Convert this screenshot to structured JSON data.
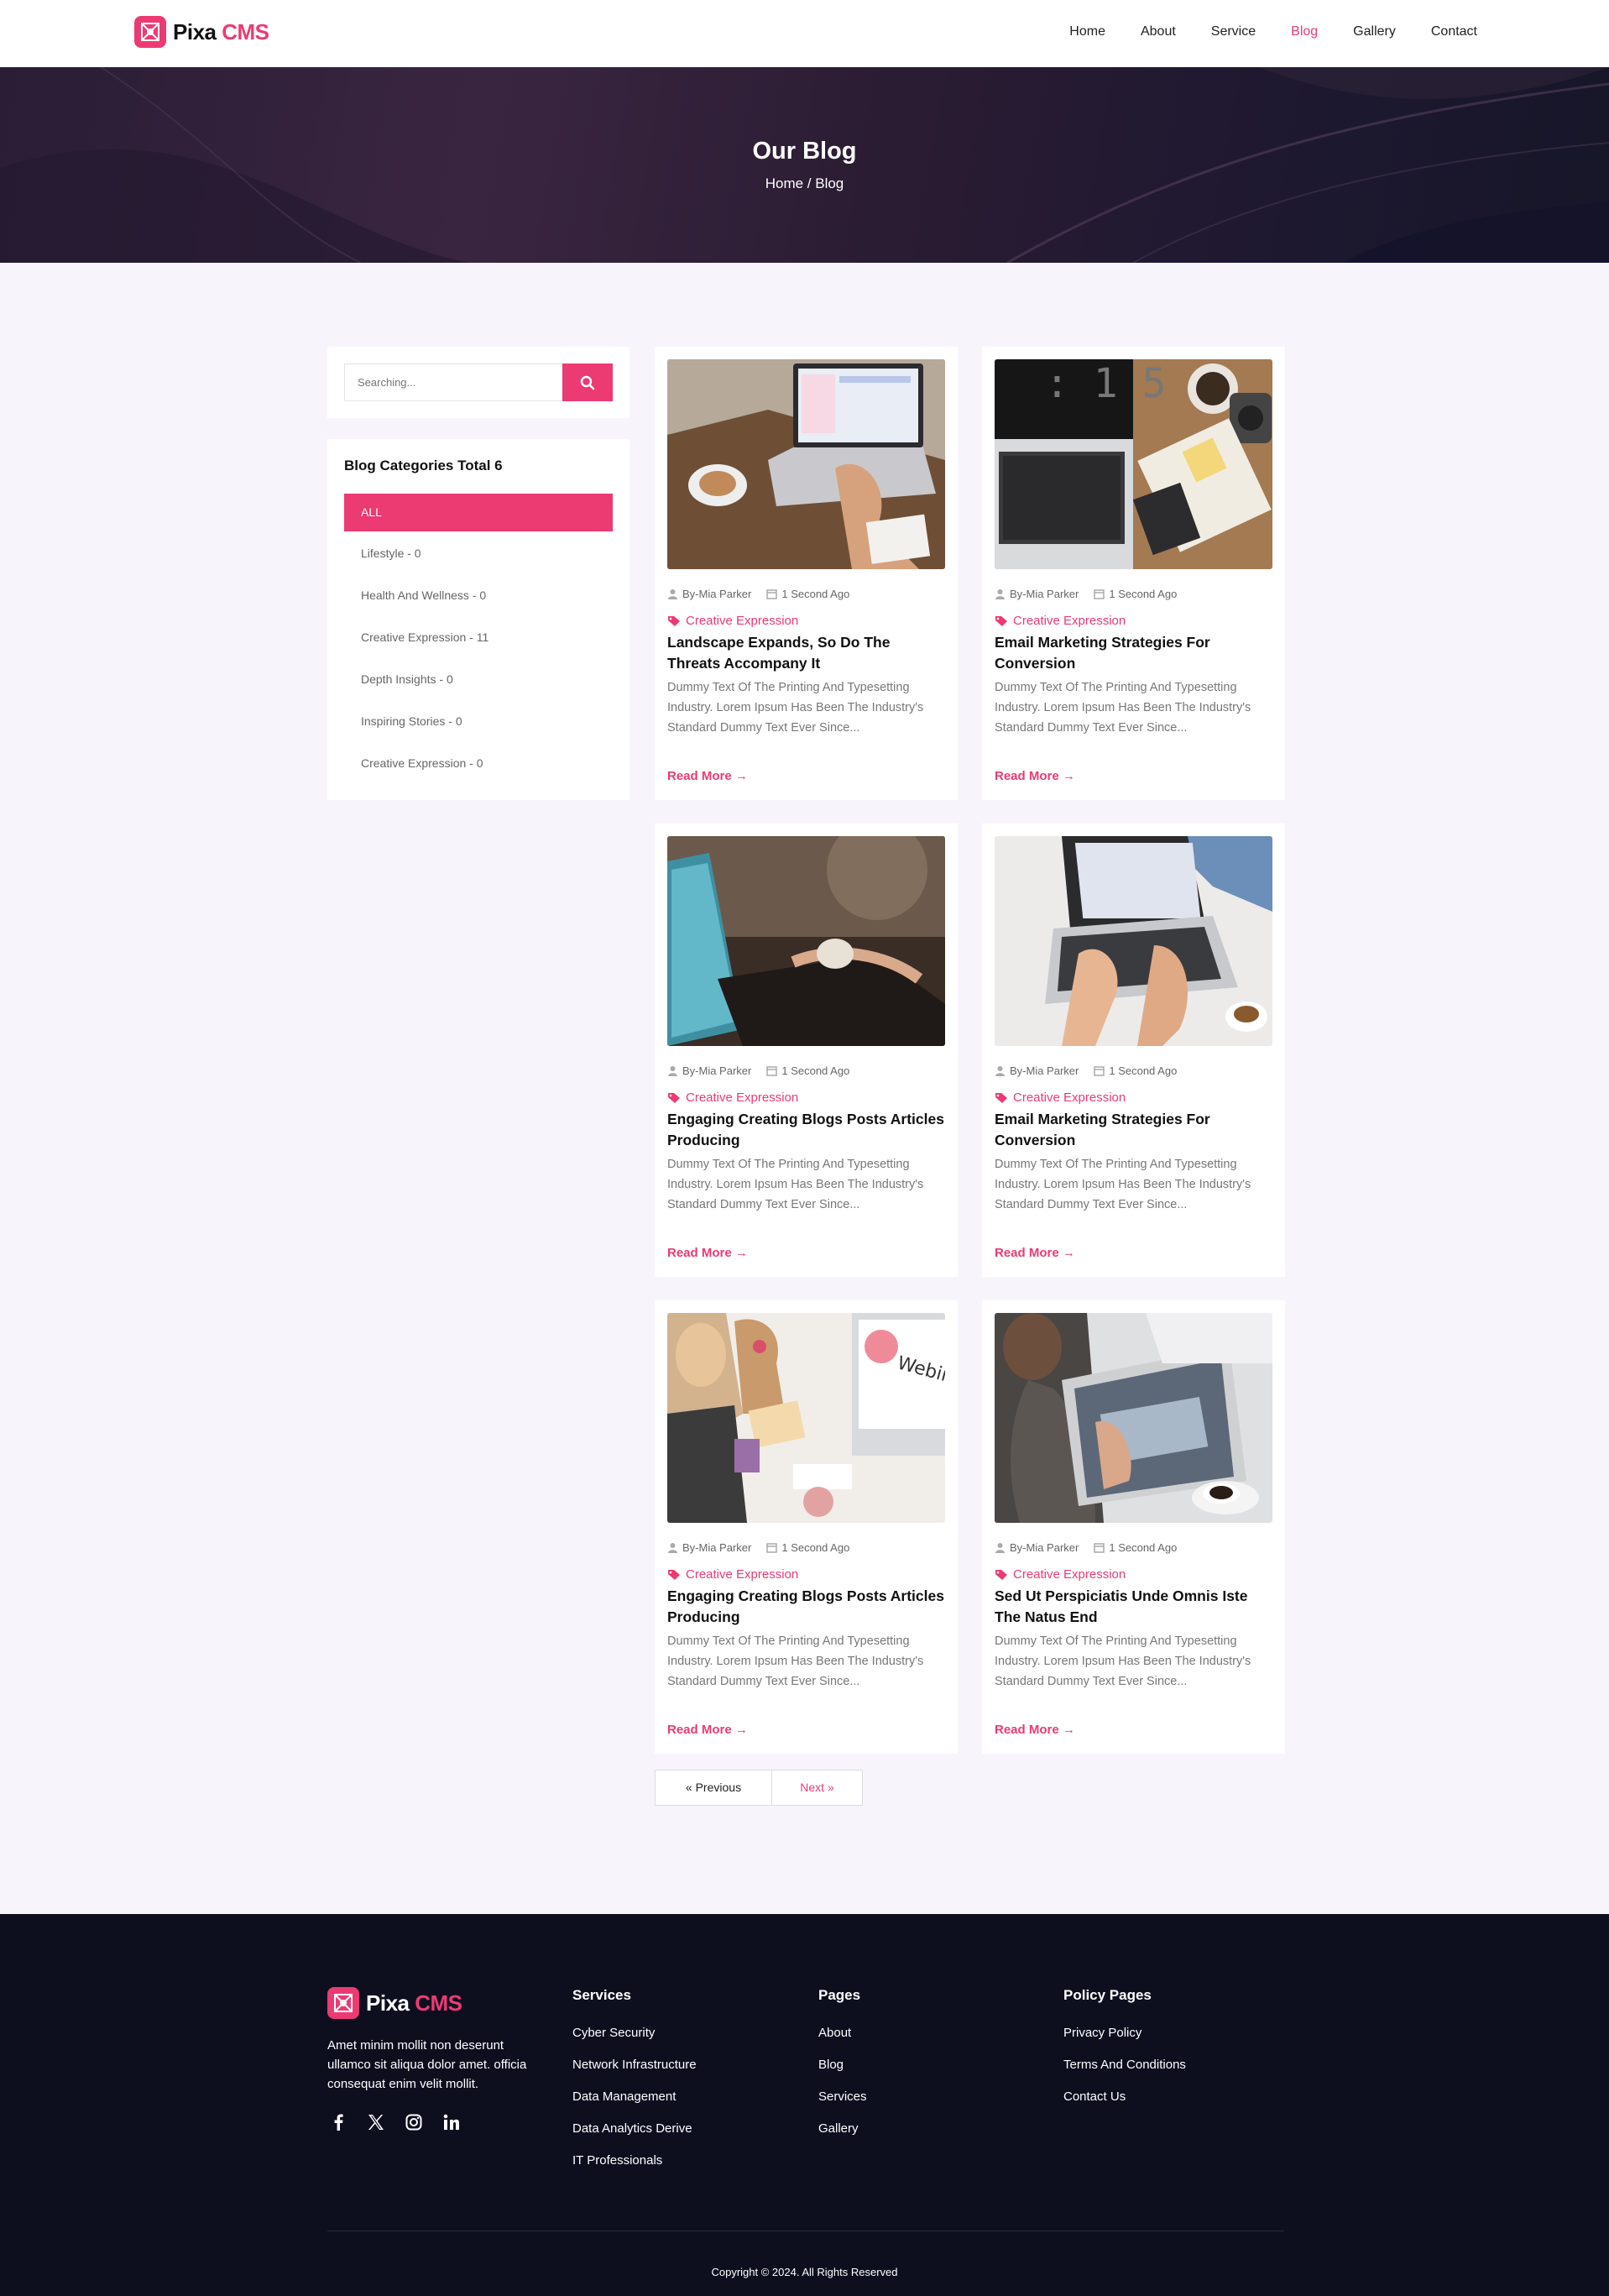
{
  "brand": {
    "name_main": "Pixa",
    "name_accent": "CMS",
    "accent_color": "#ec3a72"
  },
  "nav": {
    "items": [
      {
        "label": "Home",
        "active": false
      },
      {
        "label": "About",
        "active": false
      },
      {
        "label": "Service",
        "active": false
      },
      {
        "label": "Blog",
        "active": true
      },
      {
        "label": "Gallery",
        "active": false
      },
      {
        "label": "Contact",
        "active": false
      }
    ]
  },
  "hero": {
    "title": "Our Blog",
    "breadcrumb": "Home / Blog"
  },
  "search": {
    "placeholder": "Searching...",
    "icon": "search-icon"
  },
  "categories": {
    "title": "Blog Categories Total 6",
    "all_label": "ALL",
    "items": [
      "Lifestyle - 0",
      "Health And Wellness - 0",
      "Creative Expression - 11",
      "Depth Insights - 0",
      "Inspiring Stories - 0",
      "Creative Expression - 0"
    ]
  },
  "posts": [
    {
      "author": "By-Mia Parker",
      "time": "1 Second Ago",
      "category": "Creative Expression",
      "title": "Landscape Expands, So Do The Threats Accompany It",
      "excerpt": "Dummy Text Of The Printing And Typesetting Industry. Lorem Ipsum Has Been The Industry's Standard Dummy Text Ever Since...",
      "read_more": "Read More →"
    },
    {
      "author": "By-Mia Parker",
      "time": "1 Second Ago",
      "category": "Creative Expression",
      "title": "Email Marketing Strategies For Conversion",
      "excerpt": "Dummy Text Of The Printing And Typesetting Industry. Lorem Ipsum Has Been The Industry's Standard Dummy Text Ever Since...",
      "read_more": "Read More →"
    },
    {
      "author": "By-Mia Parker",
      "time": "1 Second Ago",
      "category": "Creative Expression",
      "title": "Engaging Creating Blogs Posts Articles Producing",
      "excerpt": "Dummy Text Of The Printing And Typesetting Industry. Lorem Ipsum Has Been The Industry's Standard Dummy Text Ever Since...",
      "read_more": "Read More →"
    },
    {
      "author": "By-Mia Parker",
      "time": "1 Second Ago",
      "category": "Creative Expression",
      "title": "Email Marketing Strategies For Conversion",
      "excerpt": "Dummy Text Of The Printing And Typesetting Industry. Lorem Ipsum Has Been The Industry's Standard Dummy Text Ever Since...",
      "read_more": "Read More →"
    },
    {
      "author": "By-Mia Parker",
      "time": "1 Second Ago",
      "category": "Creative Expression",
      "title": "Engaging Creating Blogs Posts Articles Producing",
      "excerpt": "Dummy Text Of The Printing And Typesetting Industry. Lorem Ipsum Has Been The Industry's Standard Dummy Text Ever Since...",
      "read_more": "Read More →"
    },
    {
      "author": "By-Mia Parker",
      "time": "1 Second Ago",
      "category": "Creative Expression",
      "title": "Sed Ut Perspiciatis Unde Omnis Iste The Natus End",
      "excerpt": "Dummy Text Of The Printing And Typesetting Industry. Lorem Ipsum Has Been The Industry's Standard Dummy Text Ever Since...",
      "read_more": "Read More →"
    }
  ],
  "pagination": {
    "prev": "« Previous",
    "next": "Next »"
  },
  "footer": {
    "about": "Amet minim mollit non deserunt ullamco sit aliqua dolor amet. officia consequat enim velit mollit.",
    "social_icons": [
      "facebook-icon",
      "x-twitter-icon",
      "instagram-icon",
      "linkedin-icon"
    ],
    "services": {
      "title": "Services",
      "links": [
        "Cyber Security",
        "Network Infrastructure",
        "Data Management",
        "Data Analytics Derive",
        "IT Professionals"
      ]
    },
    "pages": {
      "title": "Pages",
      "links": [
        "About",
        "Blog",
        "Services",
        "Gallery"
      ]
    },
    "policy": {
      "title": "Policy Pages",
      "links": [
        "Privacy Policy",
        "Terms And Conditions",
        "Contact Us"
      ]
    },
    "copyright": "Copyright © 2024. All Rights Reserved"
  }
}
